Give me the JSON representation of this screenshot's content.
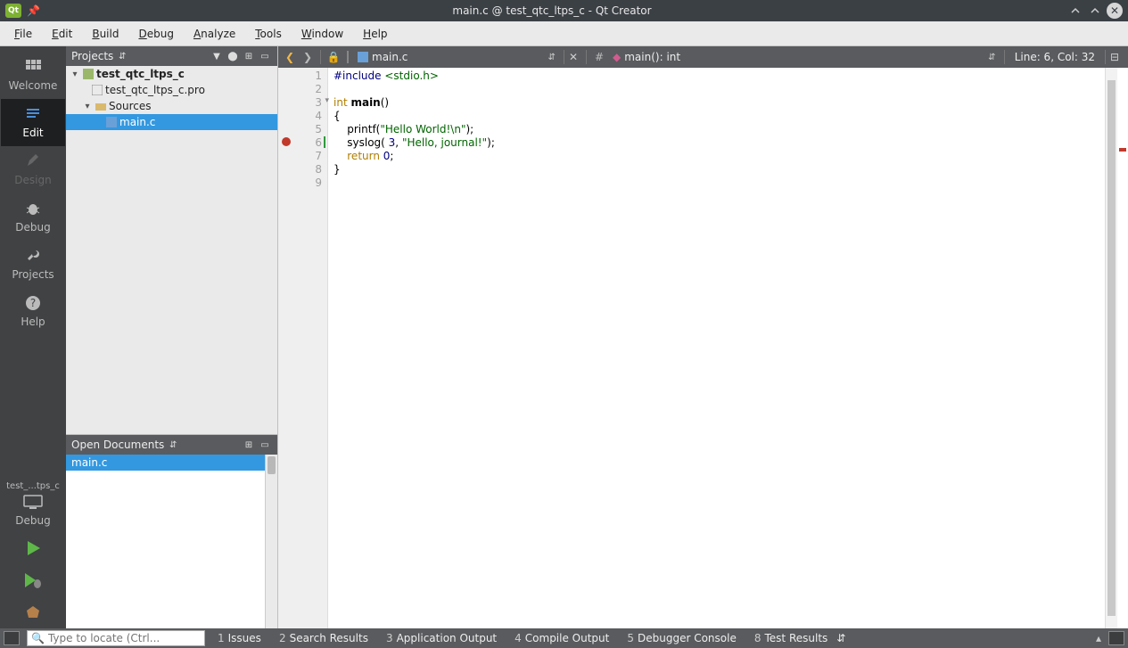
{
  "title": "main.c @ test_qtc_ltps_c - Qt Creator",
  "menus": [
    "File",
    "Edit",
    "Build",
    "Debug",
    "Analyze",
    "Tools",
    "Window",
    "Help"
  ],
  "modes": [
    {
      "label": "Welcome",
      "active": false,
      "disabled": false
    },
    {
      "label": "Edit",
      "active": true,
      "disabled": false
    },
    {
      "label": "Design",
      "active": false,
      "disabled": true
    },
    {
      "label": "Debug",
      "active": false,
      "disabled": false
    },
    {
      "label": "Projects",
      "active": false,
      "disabled": false
    },
    {
      "label": "Help",
      "active": false,
      "disabled": false
    }
  ],
  "kit_name": "test_...tps_c",
  "kit_config": "Debug",
  "projects_label": "Projects",
  "tree": {
    "project": "test_qtc_ltps_c",
    "pro_file": "test_qtc_ltps_c.pro",
    "sources_label": "Sources",
    "source_file": "main.c"
  },
  "open_docs_label": "Open Documents",
  "open_docs": [
    "main.c"
  ],
  "editor": {
    "file": "main.c",
    "symbol": "main(): int",
    "linecol": "Line: 6, Col: 32",
    "lines": [
      1,
      2,
      3,
      4,
      5,
      6,
      7,
      8,
      9
    ],
    "breakpoint_line": 6,
    "code": {
      "l1_pp": "#include ",
      "l1_inc": "<stdio.h>",
      "l3_kw1": "int ",
      "l3_fn": "main",
      "l3_rest": "()",
      "l4": "{",
      "l5_pre": "    printf(",
      "l5_str": "\"Hello World!\\n\"",
      "l5_post": ");",
      "l6_pre": "    syslog( ",
      "l6_num": "3",
      "l6_mid": ", ",
      "l6_str": "\"Hello, journal!\"",
      "l6_post": ");",
      "l7_pre": "    ",
      "l7_kw": "return ",
      "l7_num": "0",
      "l7_post": ";",
      "l8": "}"
    }
  },
  "locator_placeholder": "Type to locate (Ctrl...",
  "outputs": [
    {
      "n": "1",
      "label": "Issues"
    },
    {
      "n": "2",
      "label": "Search Results"
    },
    {
      "n": "3",
      "label": "Application Output"
    },
    {
      "n": "4",
      "label": "Compile Output"
    },
    {
      "n": "5",
      "label": "Debugger Console"
    },
    {
      "n": "8",
      "label": "Test Results"
    }
  ]
}
